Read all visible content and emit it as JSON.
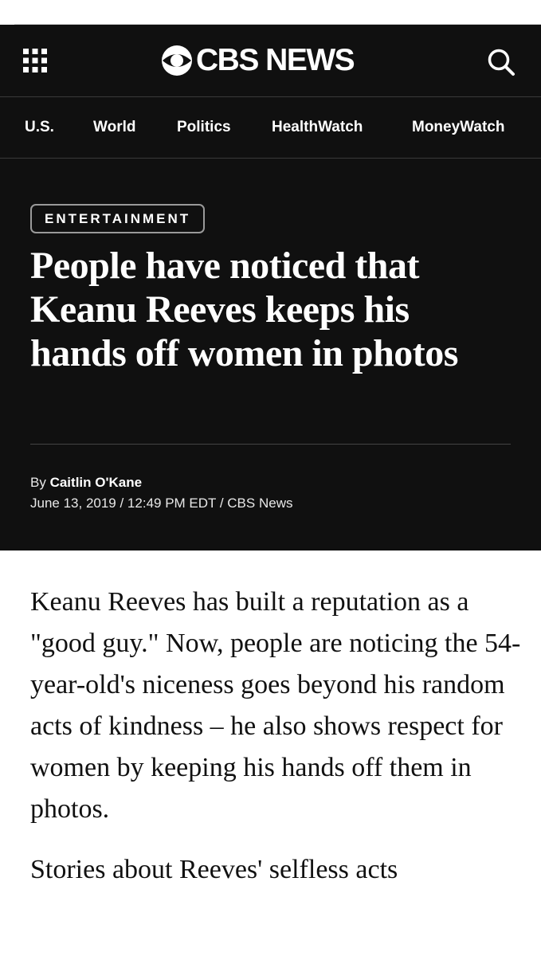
{
  "header": {
    "logo_text": "CBS NEWS",
    "menu_icon": "grid-menu-icon",
    "search_icon": "search-icon",
    "background_color": "#101010"
  },
  "nav": {
    "items": [
      {
        "label": "U.S."
      },
      {
        "label": "World"
      },
      {
        "label": "Politics"
      },
      {
        "label": "HealthWatch"
      },
      {
        "label": "MoneyWatch"
      }
    ]
  },
  "article": {
    "category": "ENTERTAINMENT",
    "headline": "People have noticed that Keanu Reeves keeps his hands off women in photos",
    "byline_prefix": "By",
    "author": "Caitlin O'Kane",
    "dateline": "June 13, 2019 / 12:49 PM EDT / CBS News",
    "paragraphs": [
      "Keanu Reeves has built a reputation as a \"good guy.\" Now, people are noticing the 54-year-old's niceness goes beyond his random acts of kindness – he also shows respect for women by keeping his hands off them in photos.",
      "Stories about Reeves' selfless acts"
    ]
  }
}
